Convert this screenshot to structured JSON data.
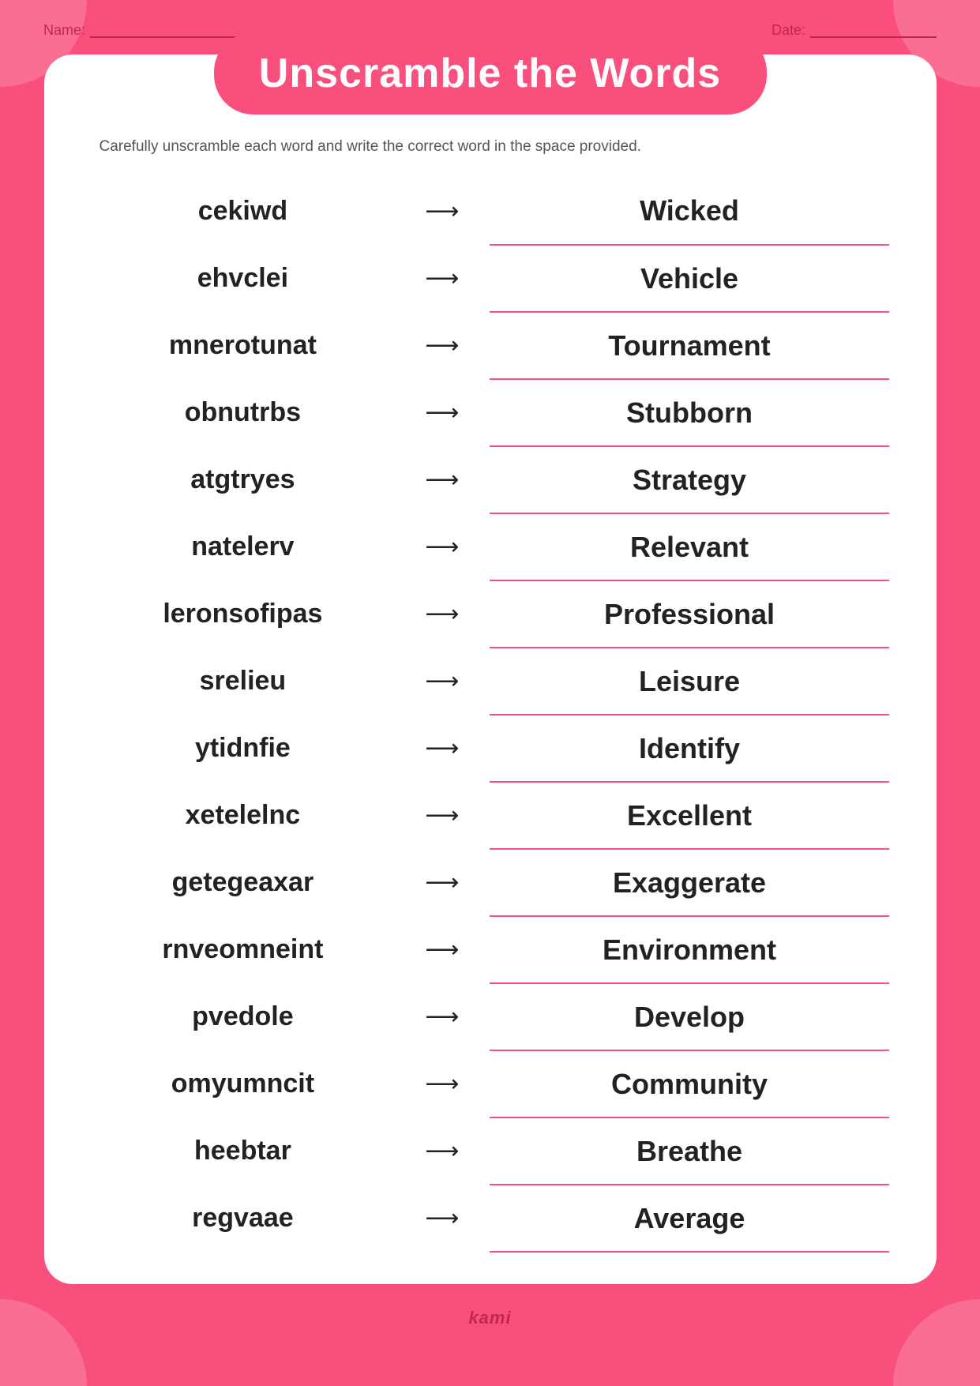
{
  "page": {
    "background_color": "#f94f7c",
    "title": "Unscramble the Words",
    "instruction": "Carefully unscramble each word and write the correct word in the space provided.",
    "name_label": "Name:",
    "date_label": "Date:",
    "footer_brand": "kami",
    "words": [
      {
        "scrambled": "cekiwd",
        "answer": "Wicked"
      },
      {
        "scrambled": "ehvclei",
        "answer": "Vehicle"
      },
      {
        "scrambled": "mnerotunat",
        "answer": "Tournament"
      },
      {
        "scrambled": "obnutrbs",
        "answer": "Stubborn"
      },
      {
        "scrambled": "atgtryes",
        "answer": "Strategy"
      },
      {
        "scrambled": "natelerv",
        "answer": "Relevant"
      },
      {
        "scrambled": "leronsofipas",
        "answer": "Professional"
      },
      {
        "scrambled": "srelieu",
        "answer": "Leisure"
      },
      {
        "scrambled": "ytidnfie",
        "answer": "Identify"
      },
      {
        "scrambled": "xetelelnc",
        "answer": "Excellent"
      },
      {
        "scrambled": "getegeaxar",
        "answer": "Exaggerate"
      },
      {
        "scrambled": "rnveomneint",
        "answer": "Environment"
      },
      {
        "scrambled": "pvedole",
        "answer": "Develop"
      },
      {
        "scrambled": "omyumncit",
        "answer": "Community"
      },
      {
        "scrambled": "heebtar",
        "answer": "Breathe"
      },
      {
        "scrambled": "regvaae",
        "answer": "Average"
      }
    ]
  }
}
